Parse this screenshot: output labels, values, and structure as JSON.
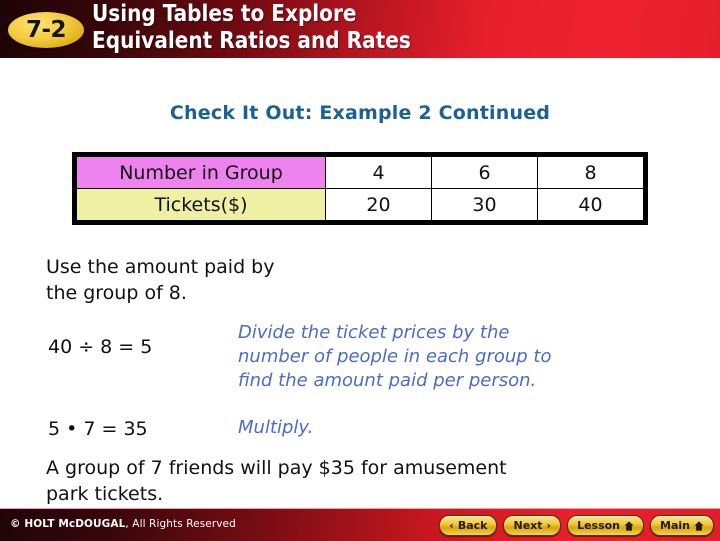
{
  "header": {
    "badge": "7-2",
    "title": "Using Tables to Explore\nEquivalent Ratios and Rates",
    "accent_red": "#e8202c",
    "badge_gold": "#f0c93c"
  },
  "slide": {
    "section_title": "Check It Out: Example 2 Continued",
    "section_title_color": "#1d6193",
    "table": {
      "rows": [
        {
          "label": "Number in Group",
          "label_bg": "#ee82ee",
          "values": [
            "4",
            "6",
            "8"
          ]
        },
        {
          "label": "Tickets($)",
          "label_bg": "#f0f0a5",
          "values": [
            "20",
            "30",
            "40"
          ]
        }
      ]
    },
    "instruction": "Use the amount paid by\nthe group of 8.",
    "steps": [
      {
        "equation": "40 ÷ 8 = 5",
        "note": "Divide the ticket prices by the\nnumber of people in each group to\nfind the amount paid per person."
      },
      {
        "equation": "5 • 7 = 35",
        "note": "Multiply."
      }
    ],
    "note_color": "#4a6cc8",
    "conclusion": "A group of 7 friends will pay $35 for amusement\npark tickets."
  },
  "footer": {
    "copyright_bold": "© HOLT McDOUGAL",
    "copyright_rest": ", All Rights Reserved",
    "buttons": [
      {
        "label": "Back",
        "icon": "chevron-left-icon",
        "glyph": "‹",
        "icon_side": "left"
      },
      {
        "label": "Next",
        "icon": "chevron-right-icon",
        "glyph": "›",
        "icon_side": "right"
      },
      {
        "label": "Lesson",
        "icon": "home-icon",
        "glyph": "",
        "icon_side": "right"
      },
      {
        "label": "Main",
        "icon": "home-icon",
        "glyph": "",
        "icon_side": "right"
      }
    ]
  }
}
